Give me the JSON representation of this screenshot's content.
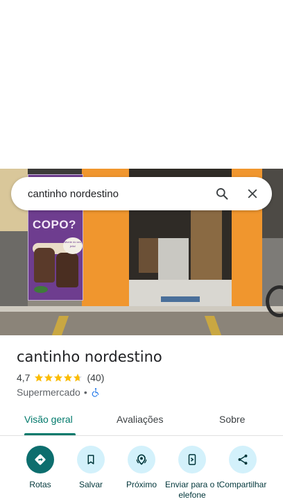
{
  "search": {
    "query": "cantinho nordestino"
  },
  "photo": {
    "poster_text": "COPO?",
    "badge_text": "Monte do seu jeito!"
  },
  "place": {
    "name": "cantinho nordestino",
    "rating": "4,7",
    "rating_value": 4.7,
    "review_count": "(40)",
    "category": "Supermercado",
    "separator": "•"
  },
  "tabs": [
    {
      "label": "Visão geral",
      "active": true
    },
    {
      "label": "Avaliações",
      "active": false
    },
    {
      "label": "Sobre",
      "active": false
    }
  ],
  "actions": [
    {
      "label": "Rotas",
      "icon": "directions-icon"
    },
    {
      "label": "Salvar",
      "icon": "bookmark-icon"
    },
    {
      "label": "Próximo",
      "icon": "nearby-icon"
    },
    {
      "label": "Enviar para o telefone",
      "icon": "send-to-phone-icon"
    },
    {
      "label": "Compartilhar",
      "icon": "share-icon"
    }
  ],
  "colors": {
    "accent": "#00796b",
    "star": "#fbbc04",
    "action_bg": "#d3f1fb",
    "primary_action_bg": "#0d6e6e",
    "accessibility": "#1a73e8"
  }
}
